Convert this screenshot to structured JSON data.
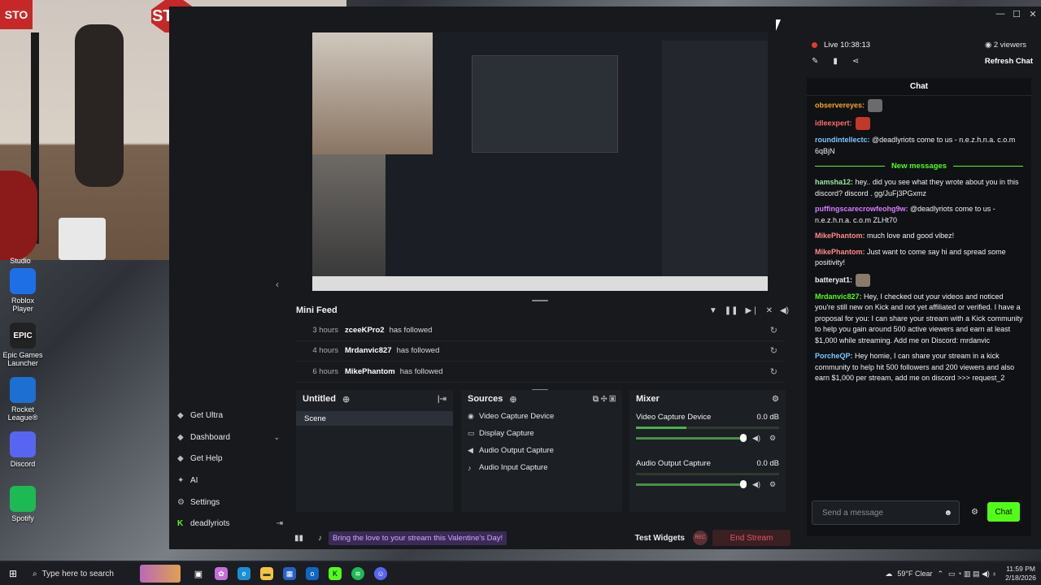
{
  "desktop": {
    "studio_label": "Studio",
    "icons": [
      {
        "label": "Roblox Player",
        "icon": "roblox-icon",
        "color": "#1e6fe6"
      },
      {
        "label": "Epic Games Launcher",
        "icon": "epic-games-icon",
        "color": "#222222",
        "glyph": "EPIC"
      },
      {
        "label": "Rocket League®",
        "icon": "rocket-league-icon",
        "color": "#1d6fd1"
      },
      {
        "label": "Discord",
        "icon": "discord-icon",
        "color": "#5865f2"
      },
      {
        "label": "Spotify",
        "icon": "spotify-icon",
        "color": "#1db954"
      }
    ],
    "webcam_stop_sign": "STOP",
    "webcam_stop_sign_left": "STO"
  },
  "window": {
    "controls": [
      "—",
      "☐",
      "✕"
    ]
  },
  "nav": {
    "items": [
      {
        "label": "Get Ultra",
        "icon": "diamond-icon"
      },
      {
        "label": "Dashboard",
        "icon": "dashboard-icon"
      },
      {
        "label": "Get Help",
        "icon": "help-icon"
      },
      {
        "label": "AI",
        "icon": "ai-sparkle-icon"
      },
      {
        "label": "Settings",
        "icon": "gear-icon"
      }
    ],
    "user": "deadlyriots"
  },
  "mini_feed": {
    "title": "Mini Feed",
    "rows": [
      {
        "time": "3 hours",
        "name": "zceeKPro2",
        "action": "has followed"
      },
      {
        "time": "4 hours",
        "name": "Mrdanvic827",
        "action": "has followed"
      },
      {
        "time": "6 hours",
        "name": "MikePhantom",
        "action": "has followed"
      }
    ]
  },
  "scenes": {
    "title": "Untitled",
    "items": [
      "Scene"
    ]
  },
  "sources": {
    "title": "Sources",
    "items": [
      {
        "label": "Video Capture Device",
        "icon": "webcam-icon"
      },
      {
        "label": "Display Capture",
        "icon": "monitor-icon"
      },
      {
        "label": "Audio Output Capture",
        "icon": "speaker-icon"
      },
      {
        "label": "Audio Input Capture",
        "icon": "microphone-icon"
      }
    ]
  },
  "mixer": {
    "title": "Mixer",
    "channels": [
      {
        "name": "Video Capture Device",
        "db": "0.0 dB",
        "meter": 0.35,
        "volume": 1.0
      },
      {
        "name": "Audio Output Capture",
        "db": "0.0 dB",
        "meter": 0.0,
        "volume": 1.0
      }
    ]
  },
  "bottom": {
    "banner": "Bring the love to your stream this Valentine's Day!",
    "test_widgets": "Test Widgets",
    "rec": "REC",
    "end_stream": "End Stream"
  },
  "chat_header": {
    "live": "Live 10:38:13",
    "viewers": "2 viewers",
    "refresh": "Refresh Chat"
  },
  "chat": {
    "title": "Chat",
    "before_new": [
      {
        "user": "observereyes:",
        "text": "",
        "color": "#f5a623",
        "emote": "#6b6b6b"
      },
      {
        "user": "idleexpert:",
        "text": "",
        "color": "#ff6b6b",
        "emote": "#c0392b"
      },
      {
        "user": "roundintellectc:",
        "text": "@deadlyriots come to us - n.e.z.h.n.a. c.o.m 6qBjN",
        "color": "#7ec8ff",
        "emote": ""
      }
    ],
    "new_messages_label": "New messages",
    "after_new": [
      {
        "user": "hamsha12:",
        "text": "hey.. did you see what they wrote about you in this discord? discord . gg/JuFj3PGxmz",
        "color": "#9be89b",
        "emote": ""
      },
      {
        "user": "puffingscarecrowfeohg9w:",
        "text": "@deadlyriots come to us - n.e.z.h.n.a. c.o.m ZLHt70",
        "color": "#d97cff",
        "emote": ""
      },
      {
        "user": "MikePhantom:",
        "text": "much love and good vibez!",
        "color": "#ff8a8a",
        "emote": ""
      },
      {
        "user": "MikePhantom:",
        "text": "Just want to come say hi and spread some positivity!",
        "color": "#ff8a8a",
        "emote": ""
      },
      {
        "user": "batteryat1:",
        "text": "",
        "color": "#f2f2f2",
        "emote": "#8a7a6a"
      },
      {
        "user": "Mrdanvic827:",
        "text": "Hey, I checked out your videos and noticed you're still new on Kick and not yet affiliated or verified. I have a proposal for you: I can share your stream with a Kick community to help you gain around 500 active viewers and earn at least $1,000 while streaming. Add me on Discord: mrdanvic",
        "color": "#53fc18",
        "emote": ""
      },
      {
        "user": "PorcheQP:",
        "text": "Hey homie, I can share your stream in a kick community to help hit 500 followers and 200 viewers and also earn $1,000 per stream, add me on discord >>> request_2",
        "color": "#7ec8ff",
        "emote": ""
      }
    ],
    "input_placeholder": "Send a message",
    "send_label": "Chat"
  },
  "taskbar": {
    "search_placeholder": "Type here to search",
    "weather": "59°F  Clear",
    "time": "11:59 PM",
    "date": "2/18/2026"
  },
  "colors": {
    "kick_green": "#53fc18",
    "live_red": "#e53935"
  }
}
